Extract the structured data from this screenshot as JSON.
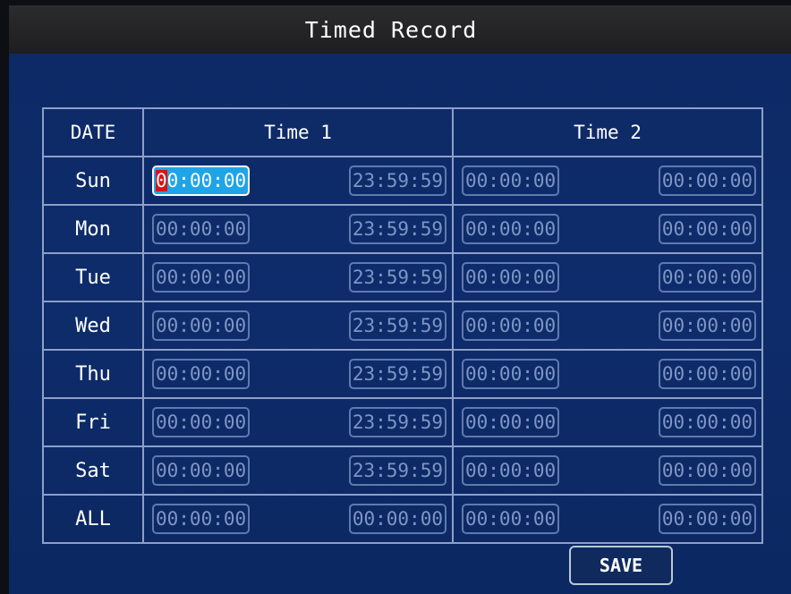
{
  "title": "Timed Record",
  "headers": {
    "date": "DATE",
    "time1": "Time 1",
    "time2": "Time 2"
  },
  "rows": [
    {
      "day": "Sun",
      "t1_start": "00:00:00",
      "t1_end": "23:59:59",
      "t2_start": "00:00:00",
      "t2_end": "00:00:00"
    },
    {
      "day": "Mon",
      "t1_start": "00:00:00",
      "t1_end": "23:59:59",
      "t2_start": "00:00:00",
      "t2_end": "00:00:00"
    },
    {
      "day": "Tue",
      "t1_start": "00:00:00",
      "t1_end": "23:59:59",
      "t2_start": "00:00:00",
      "t2_end": "00:00:00"
    },
    {
      "day": "Wed",
      "t1_start": "00:00:00",
      "t1_end": "23:59:59",
      "t2_start": "00:00:00",
      "t2_end": "00:00:00"
    },
    {
      "day": "Thu",
      "t1_start": "00:00:00",
      "t1_end": "23:59:59",
      "t2_start": "00:00:00",
      "t2_end": "00:00:00"
    },
    {
      "day": "Fri",
      "t1_start": "00:00:00",
      "t1_end": "23:59:59",
      "t2_start": "00:00:00",
      "t2_end": "00:00:00"
    },
    {
      "day": "Sat",
      "t1_start": "00:00:00",
      "t1_end": "23:59:59",
      "t2_start": "00:00:00",
      "t2_end": "00:00:00"
    },
    {
      "day": "ALL",
      "t1_start": "00:00:00",
      "t1_end": "00:00:00",
      "t2_start": "00:00:00",
      "t2_end": "00:00:00"
    }
  ],
  "active_field": {
    "cursor_char": "0",
    "rest": "0:00:00"
  },
  "save_label": "SAVE",
  "colors": {
    "background": "#0e2c6b",
    "titlebar": "#242426",
    "grid_line": "#8c9fc8",
    "field_text": "#7f95c4",
    "selected_field": "#1fa4e8",
    "cursor": "#e01010"
  }
}
